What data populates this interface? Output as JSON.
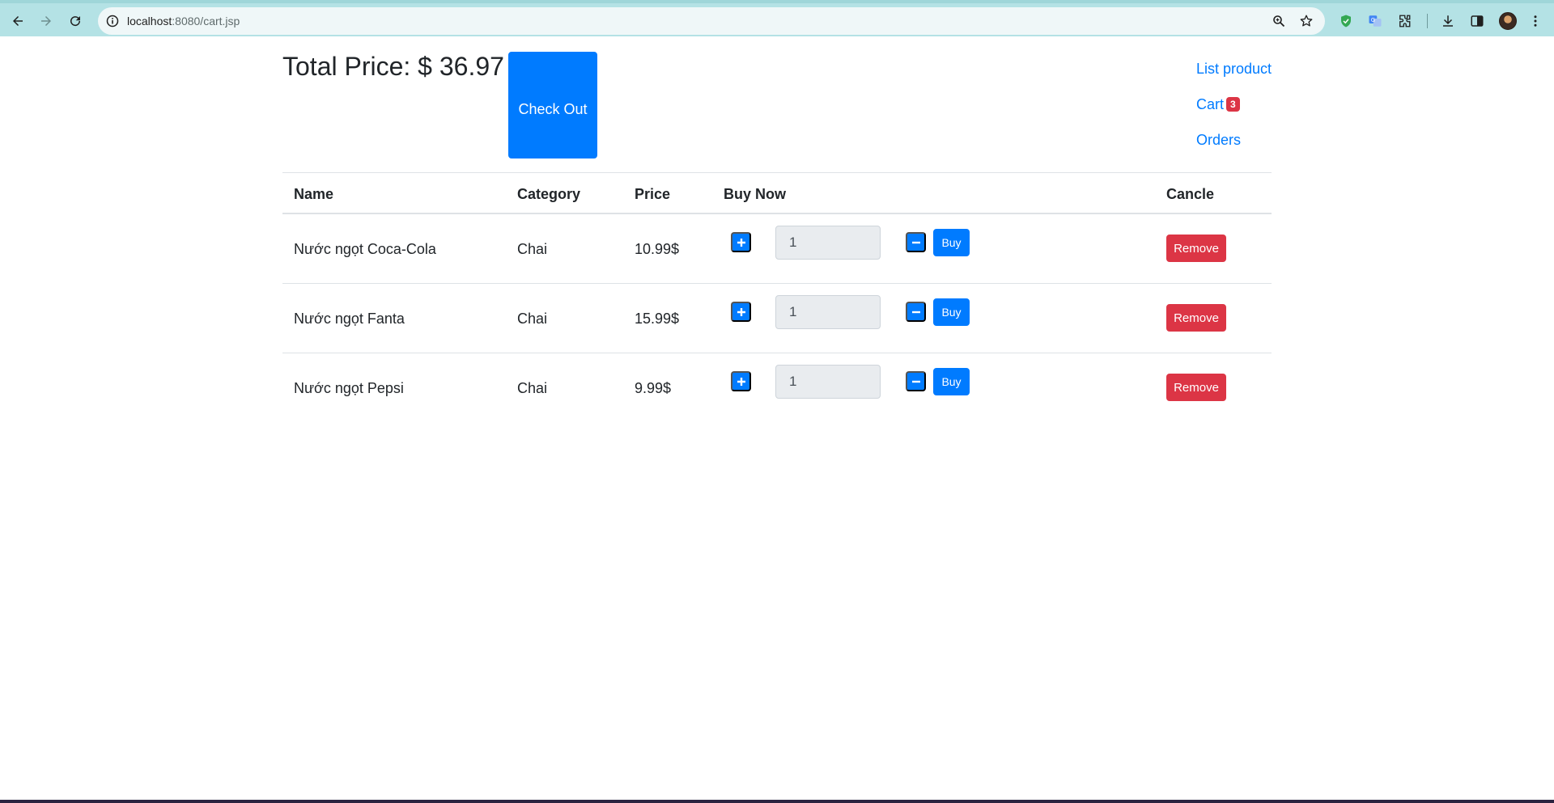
{
  "browser": {
    "url_host": "localhost",
    "url_rest": ":8080/cart.jsp"
  },
  "header": {
    "total_label": "Total Price: $ 36.97",
    "checkout_label": "Check Out"
  },
  "nav": {
    "list_product": "List product",
    "cart": "Cart",
    "cart_count": "3",
    "orders": "Orders"
  },
  "table": {
    "columns": {
      "name": "Name",
      "category": "Category",
      "price": "Price",
      "buy_now": "Buy Now",
      "cancel": "Cancle"
    },
    "rows": [
      {
        "name": "Nước ngọt Coca-Cola",
        "category": "Chai",
        "price": "10.99$",
        "qty": "1",
        "buy": "Buy",
        "remove": "Remove"
      },
      {
        "name": "Nước ngọt Fanta",
        "category": "Chai",
        "price": "15.99$",
        "qty": "1",
        "buy": "Buy",
        "remove": "Remove"
      },
      {
        "name": "Nước ngọt Pepsi",
        "category": "Chai",
        "price": "9.99$",
        "qty": "1",
        "buy": "Buy",
        "remove": "Remove"
      }
    ]
  },
  "colors": {
    "primary": "#007bff",
    "danger": "#dc3545",
    "chrome": "#b4e2e5"
  },
  "icons": [
    "back-icon",
    "forward-icon",
    "reload-icon",
    "site-info-icon",
    "zoom-icon",
    "bookmark-star-icon",
    "shield-extension-icon",
    "translate-extension-icon",
    "extensions-puzzle-icon",
    "download-icon",
    "side-panel-icon",
    "profile-avatar",
    "more-menu-icon",
    "plus-icon",
    "minus-icon"
  ]
}
